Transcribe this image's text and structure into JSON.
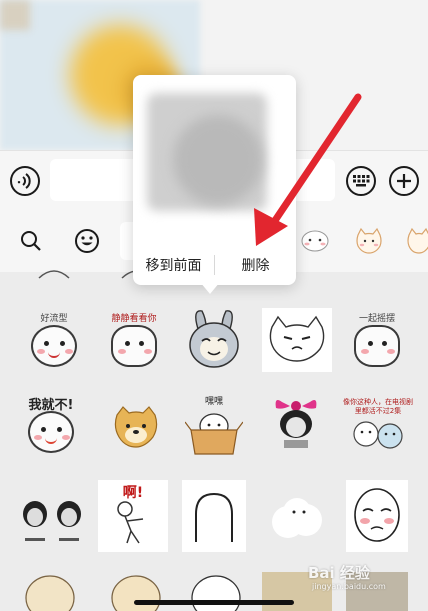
{
  "popup": {
    "move_front_label": "移到前面",
    "delete_label": "删除"
  },
  "stickers": {
    "row1": [
      "好流型",
      "静静看看你",
      "",
      "",
      "一起摇摆"
    ],
    "row2": [
      "我就不!",
      "",
      "嘿嘿",
      "",
      "像你这种人，在电视剧里都活不过2集"
    ],
    "row3": [
      "",
      "啊!",
      "",
      "",
      ""
    ]
  },
  "watermark": {
    "main": "Bai 经验",
    "sub": "jingyan.baidu.com"
  },
  "icons": {
    "voice": "voice-icon",
    "keyboard": "keyboard-icon",
    "plus": "plus-icon",
    "search": "search-icon",
    "emoji": "emoji-icon"
  },
  "colors": {
    "arrow": "#e2262f",
    "sticker_caption": "#b02020"
  }
}
